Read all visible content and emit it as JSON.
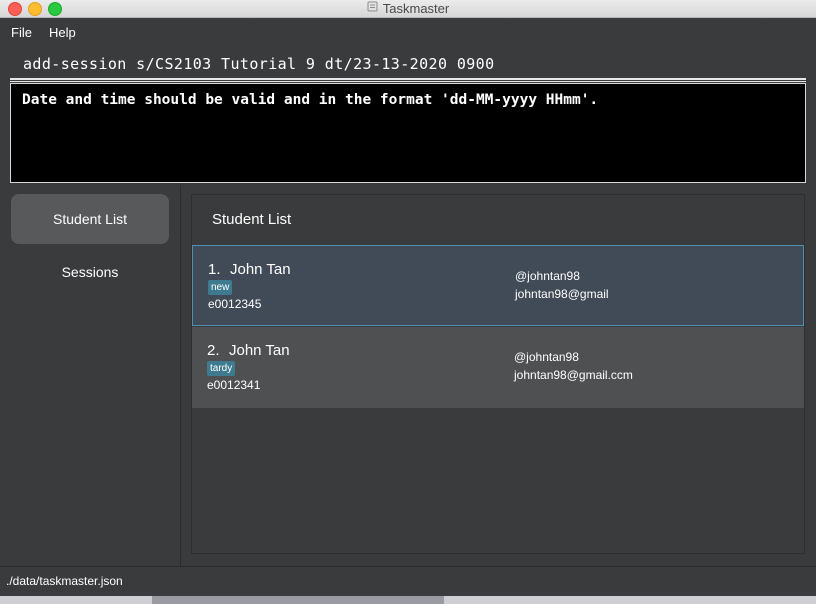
{
  "window": {
    "title": "Taskmaster",
    "app_icon": "app-icon"
  },
  "menu": {
    "items": [
      {
        "label": "File"
      },
      {
        "label": "Help"
      }
    ]
  },
  "command_box": {
    "value": "add-session s/CS2103 Tutorial 9 dt/23-13-2020 0900"
  },
  "result_display": {
    "text": "Date and time should be valid and in the format 'dd-MM-yyyy HHmm'."
  },
  "sidebar": {
    "items": [
      {
        "label": "Student List",
        "active": true
      },
      {
        "label": "Sessions",
        "active": false
      }
    ]
  },
  "student_list": {
    "header": "Student List",
    "students": [
      {
        "index": "1.",
        "name": "John Tan",
        "tag": "new",
        "id": "e0012345",
        "telegram": "@johntan98",
        "email": "johntan98@gmail"
      },
      {
        "index": "2.",
        "name": "John Tan",
        "tag": "tardy",
        "id": "e0012341",
        "telegram": "@johntan98",
        "email": "johntan98@gmail.ccm"
      }
    ]
  },
  "status_bar": {
    "path": "./data/taskmaster.json"
  },
  "colors": {
    "background": "#3a3b3d",
    "selected_row": "#414a57",
    "selected_border": "#4f8fb0",
    "tag": "#3e7b91",
    "result_bg": "#000000"
  }
}
